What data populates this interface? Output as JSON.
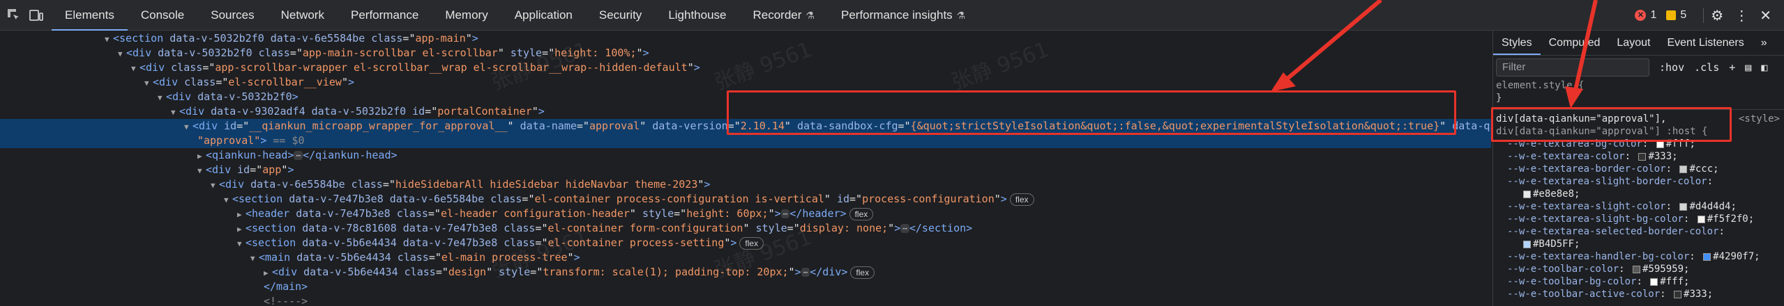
{
  "toolbar": {
    "tabs": [
      "Elements",
      "Console",
      "Sources",
      "Network",
      "Performance",
      "Memory",
      "Application",
      "Security",
      "Lighthouse",
      "Recorder",
      "Performance insights"
    ],
    "experimental_tabs": [
      9,
      10
    ],
    "errors": "1",
    "warnings": "5"
  },
  "watermark": {
    "text": "张静 9561"
  },
  "dom_lines": [
    {
      "indent": 0,
      "segs": [
        [
          "tri",
          "▼"
        ],
        [
          "tag",
          "<section "
        ],
        [
          "an",
          "data-v-5032b2f0 data-v-6e5584be "
        ],
        [
          "an",
          "class"
        ],
        [
          "tx",
          "=\""
        ],
        [
          "av",
          "app-main"
        ],
        [
          "tx",
          "\""
        ],
        [
          "tag",
          ">"
        ]
      ]
    },
    {
      "indent": 1,
      "segs": [
        [
          "tri",
          "▼"
        ],
        [
          "tag",
          "<div "
        ],
        [
          "an",
          "data-v-5032b2f0 "
        ],
        [
          "an",
          "class"
        ],
        [
          "tx",
          "=\""
        ],
        [
          "av",
          "app-main-scrollbar el-scrollbar"
        ],
        [
          "tx",
          "\" "
        ],
        [
          "an",
          "style"
        ],
        [
          "tx",
          "=\""
        ],
        [
          "av",
          "height: 100%;"
        ],
        [
          "tx",
          "\""
        ],
        [
          "tag",
          ">"
        ]
      ]
    },
    {
      "indent": 2,
      "segs": [
        [
          "tri",
          "▼"
        ],
        [
          "tag",
          "<div "
        ],
        [
          "an",
          "class"
        ],
        [
          "tx",
          "=\""
        ],
        [
          "av",
          "app-scrollbar-wrapper el-scrollbar__wrap el-scrollbar__wrap--hidden-default"
        ],
        [
          "tx",
          "\""
        ],
        [
          "tag",
          ">"
        ]
      ]
    },
    {
      "indent": 3,
      "segs": [
        [
          "tri",
          "▼"
        ],
        [
          "tag",
          "<div "
        ],
        [
          "an",
          "class"
        ],
        [
          "tx",
          "=\""
        ],
        [
          "av",
          "el-scrollbar__view"
        ],
        [
          "tx",
          "\""
        ],
        [
          "tag",
          ">"
        ]
      ]
    },
    {
      "indent": 4,
      "segs": [
        [
          "tri",
          "▼"
        ],
        [
          "tag",
          "<div "
        ],
        [
          "an",
          "data-v-5032b2f0"
        ],
        [
          "tag",
          ">"
        ]
      ]
    },
    {
      "indent": 5,
      "segs": [
        [
          "tri",
          "▼"
        ],
        [
          "tag",
          "<div "
        ],
        [
          "an",
          "data-v-9302adf4 data-v-5032b2f0 "
        ],
        [
          "an",
          "id"
        ],
        [
          "tx",
          "=\""
        ],
        [
          "av",
          "portalContainer"
        ],
        [
          "tx",
          "\""
        ],
        [
          "tag",
          ">"
        ]
      ]
    },
    {
      "indent": 6,
      "sel": true,
      "segs": [
        [
          "tri",
          "▼"
        ],
        [
          "tag",
          "<div "
        ],
        [
          "an",
          "id"
        ],
        [
          "tx",
          "=\""
        ],
        [
          "av",
          "__qiankun_microapp_wrapper_for_approval__"
        ],
        [
          "tx",
          "\" "
        ],
        [
          "an",
          "data-name"
        ],
        [
          "tx",
          "=\""
        ],
        [
          "av",
          "approval"
        ],
        [
          "tx",
          "\" "
        ],
        [
          "an",
          "data-version"
        ],
        [
          "tx",
          "=\""
        ],
        [
          "av",
          "2.10.14"
        ],
        [
          "tx",
          "\" "
        ],
        [
          "an",
          "data-sandbox-cfg"
        ],
        [
          "tx",
          "=\""
        ],
        [
          "av",
          "{&quot;strictStyleIsolation&quot;:false,&quot;experimentalStyleIsolation&quot;:true}"
        ],
        [
          "tx",
          "\" "
        ],
        [
          "an",
          "data-qiankun"
        ],
        [
          "tx",
          "="
        ]
      ]
    },
    {
      "indent": 7,
      "sel": true,
      "segs": [
        [
          "av",
          "\"approval\""
        ],
        [
          "tag",
          ">"
        ],
        [
          "cm",
          " == $0"
        ]
      ]
    },
    {
      "indent": 7,
      "segs": [
        [
          "tri",
          "▶"
        ],
        [
          "tag",
          "<qiankun-head>"
        ],
        [
          "ell",
          "⋯"
        ],
        [
          "tag",
          "</qiankun-head>"
        ]
      ]
    },
    {
      "indent": 7,
      "segs": [
        [
          "tri",
          "▼"
        ],
        [
          "tag",
          "<div "
        ],
        [
          "an",
          "id"
        ],
        [
          "tx",
          "=\""
        ],
        [
          "av",
          "app"
        ],
        [
          "tx",
          "\""
        ],
        [
          "tag",
          ">"
        ]
      ]
    },
    {
      "indent": 8,
      "segs": [
        [
          "tri",
          "▼"
        ],
        [
          "tag",
          "<div "
        ],
        [
          "an",
          "data-v-6e5584be "
        ],
        [
          "an",
          "class"
        ],
        [
          "tx",
          "=\""
        ],
        [
          "av",
          "hideSidebarAll hideSidebar hideNavbar theme-2023"
        ],
        [
          "tx",
          "\""
        ],
        [
          "tag",
          ">"
        ]
      ]
    },
    {
      "indent": 9,
      "segs": [
        [
          "tri",
          "▼"
        ],
        [
          "tag",
          "<section "
        ],
        [
          "an",
          "data-v-7e47b3e8 data-v-6e5584be "
        ],
        [
          "an",
          "class"
        ],
        [
          "tx",
          "=\""
        ],
        [
          "av",
          "el-container process-configuration is-vertical"
        ],
        [
          "tx",
          "\" "
        ],
        [
          "an",
          "id"
        ],
        [
          "tx",
          "=\""
        ],
        [
          "av",
          "process-configuration"
        ],
        [
          "tx",
          "\""
        ],
        [
          "tag",
          ">"
        ],
        [
          "pill",
          "flex"
        ]
      ]
    },
    {
      "indent": 10,
      "segs": [
        [
          "tri",
          "▶"
        ],
        [
          "tag",
          "<header "
        ],
        [
          "an",
          "data-v-7e47b3e8 "
        ],
        [
          "an",
          "class"
        ],
        [
          "tx",
          "=\""
        ],
        [
          "av",
          "el-header configuration-header"
        ],
        [
          "tx",
          "\" "
        ],
        [
          "an",
          "style"
        ],
        [
          "tx",
          "=\""
        ],
        [
          "av",
          "height: 60px;"
        ],
        [
          "tx",
          "\""
        ],
        [
          "tag",
          ">"
        ],
        [
          "ell",
          "⋯"
        ],
        [
          "tag",
          "</header>"
        ],
        [
          "pill",
          "flex"
        ]
      ]
    },
    {
      "indent": 10,
      "segs": [
        [
          "tri",
          "▶"
        ],
        [
          "tag",
          "<section "
        ],
        [
          "an",
          "data-v-78c81608 data-v-7e47b3e8 "
        ],
        [
          "an",
          "class"
        ],
        [
          "tx",
          "=\""
        ],
        [
          "av",
          "el-container form-configuration"
        ],
        [
          "tx",
          "\" "
        ],
        [
          "an",
          "style"
        ],
        [
          "tx",
          "=\""
        ],
        [
          "av",
          "display: none;"
        ],
        [
          "tx",
          "\""
        ],
        [
          "tag",
          ">"
        ],
        [
          "ell",
          "⋯"
        ],
        [
          "tag",
          "</section>"
        ]
      ]
    },
    {
      "indent": 10,
      "segs": [
        [
          "tri",
          "▼"
        ],
        [
          "tag",
          "<section "
        ],
        [
          "an",
          "data-v-5b6e4434 data-v-7e47b3e8 "
        ],
        [
          "an",
          "class"
        ],
        [
          "tx",
          "=\""
        ],
        [
          "av",
          "el-container process-setting"
        ],
        [
          "tx",
          "\""
        ],
        [
          "tag",
          ">"
        ],
        [
          "pill",
          "flex"
        ]
      ]
    },
    {
      "indent": 11,
      "segs": [
        [
          "tri",
          "▼"
        ],
        [
          "tag",
          "<main "
        ],
        [
          "an",
          "data-v-5b6e4434 "
        ],
        [
          "an",
          "class"
        ],
        [
          "tx",
          "=\""
        ],
        [
          "av",
          "el-main process-tree"
        ],
        [
          "tx",
          "\""
        ],
        [
          "tag",
          ">"
        ]
      ]
    },
    {
      "indent": 12,
      "segs": [
        [
          "tri",
          "▶"
        ],
        [
          "tag",
          "<div "
        ],
        [
          "an",
          "data-v-5b6e4434 "
        ],
        [
          "an",
          "class"
        ],
        [
          "tx",
          "=\""
        ],
        [
          "av",
          "design"
        ],
        [
          "tx",
          "\" "
        ],
        [
          "an",
          "style"
        ],
        [
          "tx",
          "=\""
        ],
        [
          "av",
          "transform: scale(1); padding-top: 20px;"
        ],
        [
          "tx",
          "\""
        ],
        [
          "tag",
          ">"
        ],
        [
          "ell",
          "⋯"
        ],
        [
          "tag",
          "</div>"
        ],
        [
          "pill",
          "flex"
        ]
      ]
    },
    {
      "indent": 12,
      "segs": [
        [
          "tag",
          "</main>"
        ]
      ]
    },
    {
      "indent": 12,
      "segs": [
        [
          "cm",
          "<!---->"
        ]
      ]
    }
  ],
  "styles": {
    "tabs": [
      "Styles",
      "Computed",
      "Layout",
      "Event Listeners",
      "»"
    ],
    "filter_placeholder": "Filter",
    "hov": ":hov",
    "cls": ".cls",
    "element_style": "element.style {",
    "close_brace": "}",
    "selector1": "div[data-qiankun=\"approval\"],",
    "selector2": "div[data-qiankun=\"approval\"] :host {",
    "source": "<style>",
    "props": [
      {
        "name": "--w-e-textarea-bg-color",
        "value": "#fff",
        "color": "#ffffff"
      },
      {
        "name": "--w-e-textarea-color",
        "value": "#333",
        "color": "#333333"
      },
      {
        "name": "--w-e-textarea-border-color",
        "value": "#ccc",
        "color": "#cccccc"
      },
      {
        "name": "--w-e-textarea-slight-border-color",
        "value": "",
        "color": ""
      },
      {
        "name": "",
        "value": "#e8e8e8",
        "color": "#e8e8e8",
        "cont": true
      },
      {
        "name": "--w-e-textarea-slight-color",
        "value": "#d4d4d4",
        "color": "#d4d4d4"
      },
      {
        "name": "--w-e-textarea-slight-bg-color",
        "value": "#f5f2f0",
        "color": "#f5f2f0"
      },
      {
        "name": "--w-e-textarea-selected-border-color",
        "value": "",
        "color": ""
      },
      {
        "name": "",
        "value": "#B4D5FF",
        "color": "#B4D5FF",
        "cont": true
      },
      {
        "name": "--w-e-textarea-handler-bg-color",
        "value": "#4290f7",
        "color": "#4290f7"
      },
      {
        "name": "--w-e-toolbar-color",
        "value": "#595959",
        "color": "#595959"
      },
      {
        "name": "--w-e-toolbar-bg-color",
        "value": "#fff",
        "color": "#ffffff"
      },
      {
        "name": "--w-e-toolbar-active-color",
        "value": "#333",
        "color": "#333333"
      }
    ]
  },
  "icons": {
    "inspect": "inspect-element-icon",
    "device": "device-toolbar-icon",
    "settings": "gear-icon",
    "more": "kebab-menu-icon",
    "close": "close-icon"
  }
}
